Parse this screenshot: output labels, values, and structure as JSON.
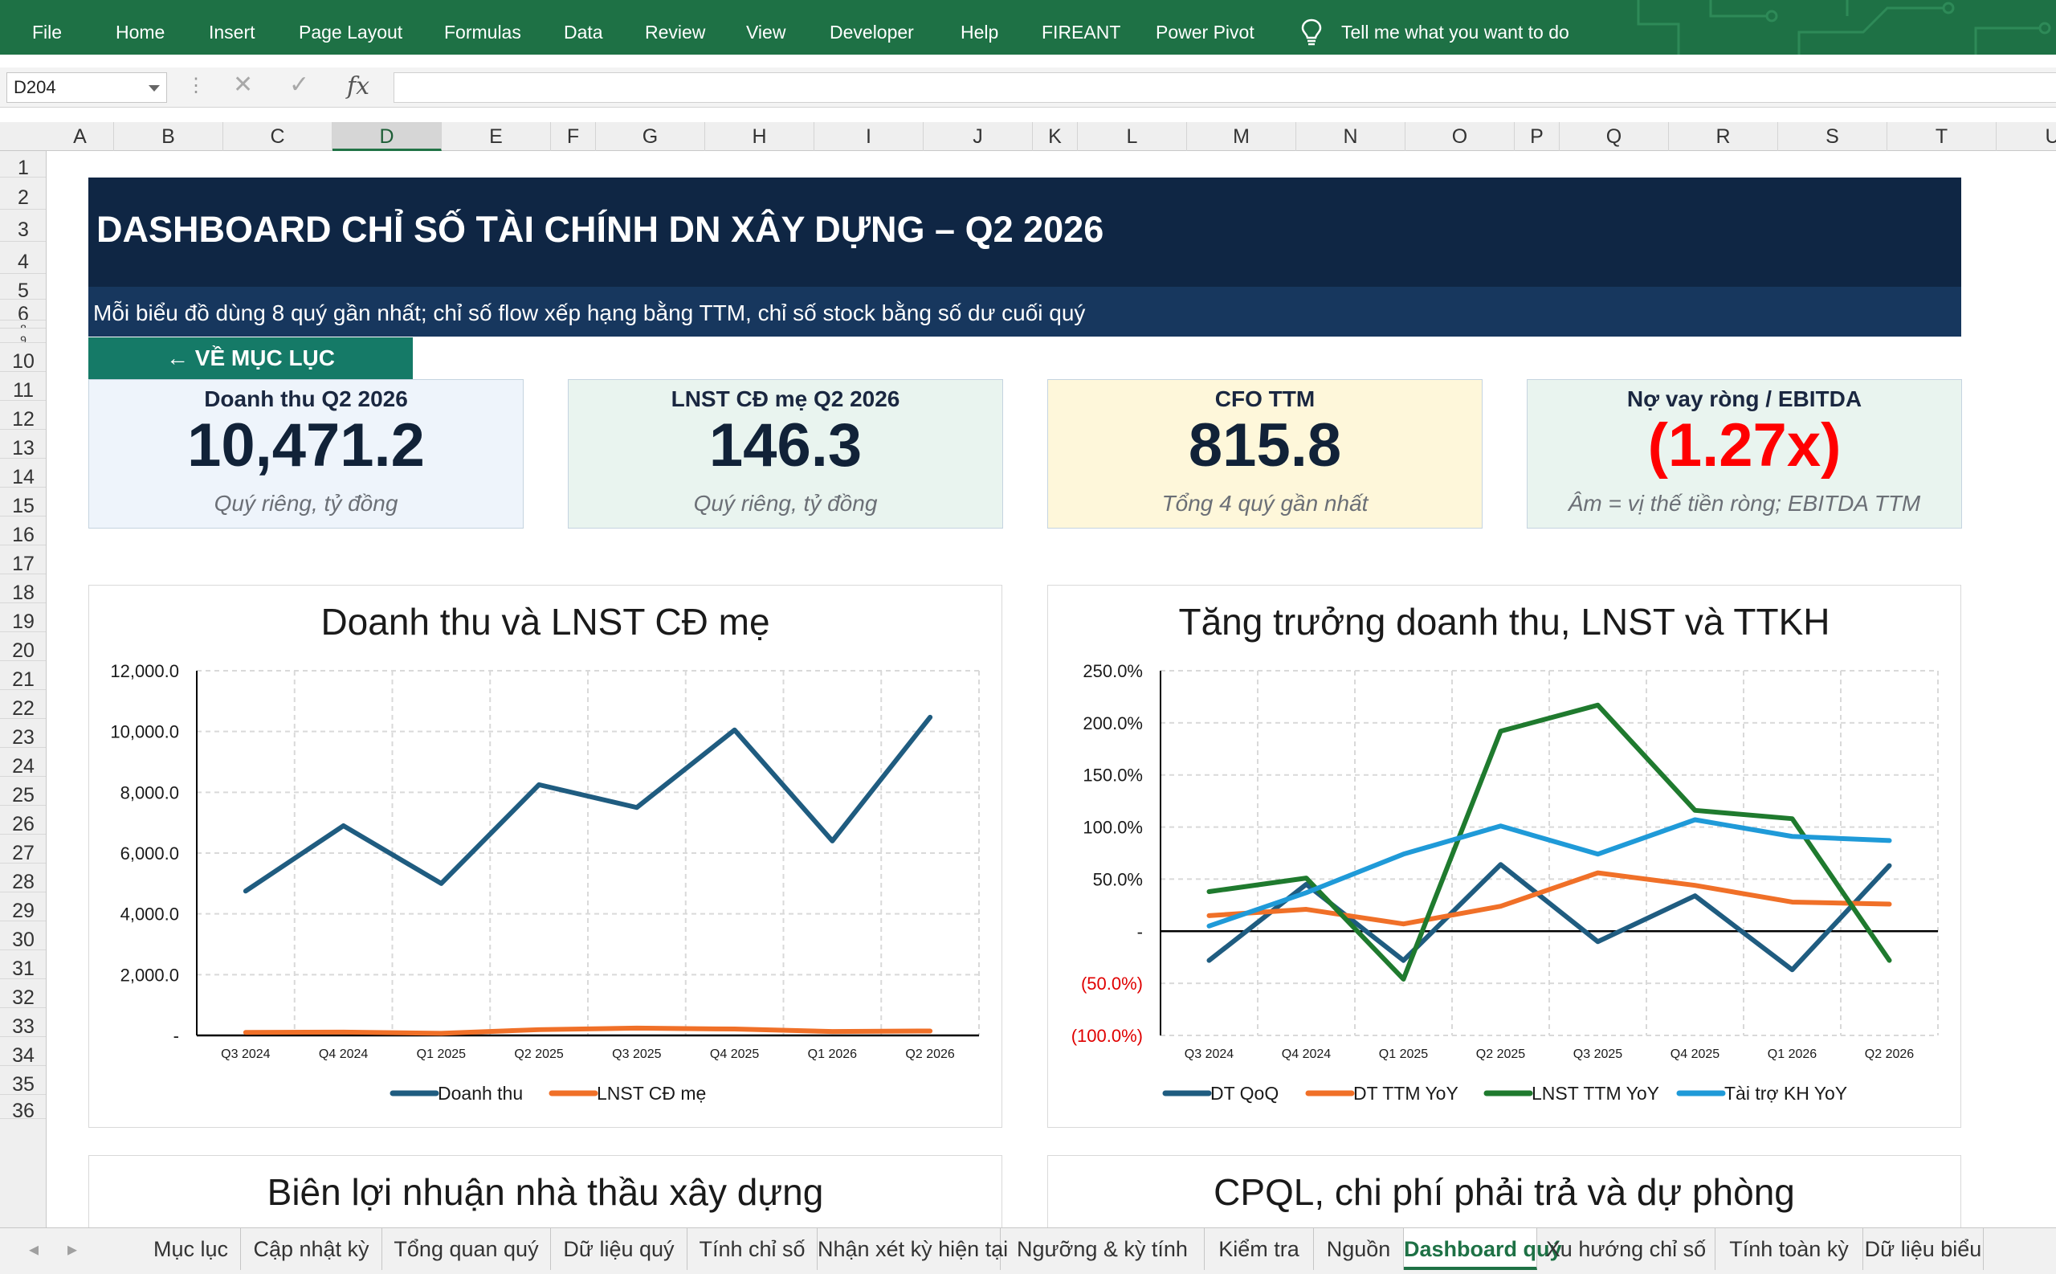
{
  "ribbon": {
    "tabs": [
      "File",
      "Home",
      "Insert",
      "Page Layout",
      "Formulas",
      "Data",
      "Review",
      "View",
      "Developer",
      "Help",
      "FIREANT",
      "Power Pivot"
    ],
    "tell_me": "Tell me what you want to do"
  },
  "formula_bar": {
    "name_box": "D204",
    "fx_label": "fx",
    "formula": ""
  },
  "grid": {
    "columns": [
      "A",
      "B",
      "C",
      "D",
      "E",
      "F",
      "G",
      "H",
      "I",
      "J",
      "K",
      "L",
      "M",
      "N",
      "O",
      "P",
      "Q",
      "R",
      "S",
      "T",
      "U"
    ],
    "selected_column": "D",
    "rows": [
      "1",
      "2",
      "3",
      "4",
      "5",
      "6",
      "8",
      "9",
      "10",
      "11",
      "12",
      "13",
      "14",
      "15",
      "16",
      "17",
      "18",
      "19",
      "20",
      "21",
      "22",
      "23",
      "24",
      "25",
      "26",
      "27",
      "28",
      "29",
      "30",
      "31",
      "32",
      "33",
      "34",
      "35",
      "36"
    ]
  },
  "dashboard": {
    "title": "DASHBOARD CHỈ SỐ TÀI CHÍNH DN XÂY DỰNG – Q2 2026",
    "subtitle": "Mỗi biểu đồ dùng 8 quý gần nhất; chỉ số flow xếp hạng bằng TTM, chỉ số stock bằng số dư cuối quý",
    "back_button": "← VỀ MỤC LỤC",
    "kpis": [
      {
        "label": "Doanh thu Q2 2026",
        "value": "10,471.2",
        "note": "Quý riêng, tỷ đồng",
        "bg": "#eef4fb",
        "value_color": "#112238"
      },
      {
        "label": "LNST CĐ mẹ Q2 2026",
        "value": "146.3",
        "note": "Quý riêng, tỷ đồng",
        "bg": "#e9f4ef",
        "value_color": "#112238"
      },
      {
        "label": "CFO TTM",
        "value": "815.8",
        "note": "Tổng 4 quý gần nhất",
        "bg": "#fef7da",
        "value_color": "#112238"
      },
      {
        "label": "Nợ vay ròng / EBITDA",
        "value": "(1.27x)",
        "note": "Âm = vị thế tiền ròng; EBITDA TTM",
        "bg": "#e9f4ef",
        "value_color": "#ff0000"
      }
    ],
    "bottom_chart_titles": [
      "Biên lợi nhuận nhà thầu xây dựng",
      "CPQL, chi phí phải trả và dự phòng"
    ]
  },
  "chart_data": [
    {
      "type": "line",
      "title": "Doanh thu và LNST CĐ mẹ",
      "categories": [
        "Q3 2024",
        "Q4 2024",
        "Q1 2025",
        "Q2 2025",
        "Q3 2025",
        "Q4 2025",
        "Q1 2026",
        "Q2 2026"
      ],
      "ylim": [
        0,
        12000
      ],
      "yticks": [
        0,
        2000,
        4000,
        6000,
        8000,
        10000,
        12000
      ],
      "ytick_labels": [
        "-",
        "2,000.0",
        "4,000.0",
        "6,000.0",
        "8,000.0",
        "10,000.0",
        "12,000.0"
      ],
      "grid": true,
      "legend": "bottom",
      "series": [
        {
          "name": "Doanh thu",
          "color": "#1f5c80",
          "values": [
            4750,
            6900,
            5000,
            8250,
            7500,
            10050,
            6400,
            10471.2
          ]
        },
        {
          "name": "LNST CĐ mẹ",
          "color": "#f07028",
          "values": [
            100,
            110,
            70,
            190,
            240,
            210,
            130,
            146.3
          ]
        }
      ]
    },
    {
      "type": "line",
      "title": "Tăng trưởng doanh thu, LNST và TTKH",
      "categories": [
        "Q3 2024",
        "Q4 2024",
        "Q1 2025",
        "Q2 2025",
        "Q3 2025",
        "Q4 2025",
        "Q1 2026",
        "Q2 2026"
      ],
      "ylim": [
        -100,
        250
      ],
      "yticks": [
        -100,
        -50,
        0,
        50,
        100,
        150,
        200,
        250
      ],
      "ytick_labels": [
        "(100.0%)",
        "(50.0%)",
        "-",
        "50.0%",
        "100.0%",
        "150.0%",
        "200.0%",
        "250.0%"
      ],
      "negative_label_color": "#e00000",
      "grid": true,
      "legend": "bottom",
      "series": [
        {
          "name": "DT QoQ",
          "color": "#1f5c80",
          "values": [
            -28,
            45,
            -28,
            64,
            -10,
            34,
            -37,
            63
          ]
        },
        {
          "name": "DT TTM YoY",
          "color": "#f07028",
          "values": [
            15,
            21,
            7,
            24,
            56,
            44,
            28,
            26
          ]
        },
        {
          "name": "LNST TTM YoY",
          "color": "#1f7a2e",
          "values": [
            38,
            51,
            -46,
            192,
            217,
            116,
            108,
            -28
          ]
        },
        {
          "name": "Tài trợ KH YoY",
          "color": "#1f9ad8",
          "values": [
            5,
            37,
            74,
            101,
            74,
            107,
            91,
            87
          ]
        }
      ]
    }
  ],
  "sheet_tabs": [
    "Mục lục",
    "Cập nhật kỳ",
    "Tổng quan quý",
    "Dữ liệu quý",
    "Tính chỉ số",
    "Nhận xét kỳ hiện tại",
    "Ngưỡng & kỳ tính",
    "Kiểm tra",
    "Nguồn",
    "Dashboard quý",
    "Xu hướng chỉ số",
    "Tính toàn kỳ",
    "Dữ liệu biểu"
  ],
  "active_sheet": "Dashboard quý"
}
